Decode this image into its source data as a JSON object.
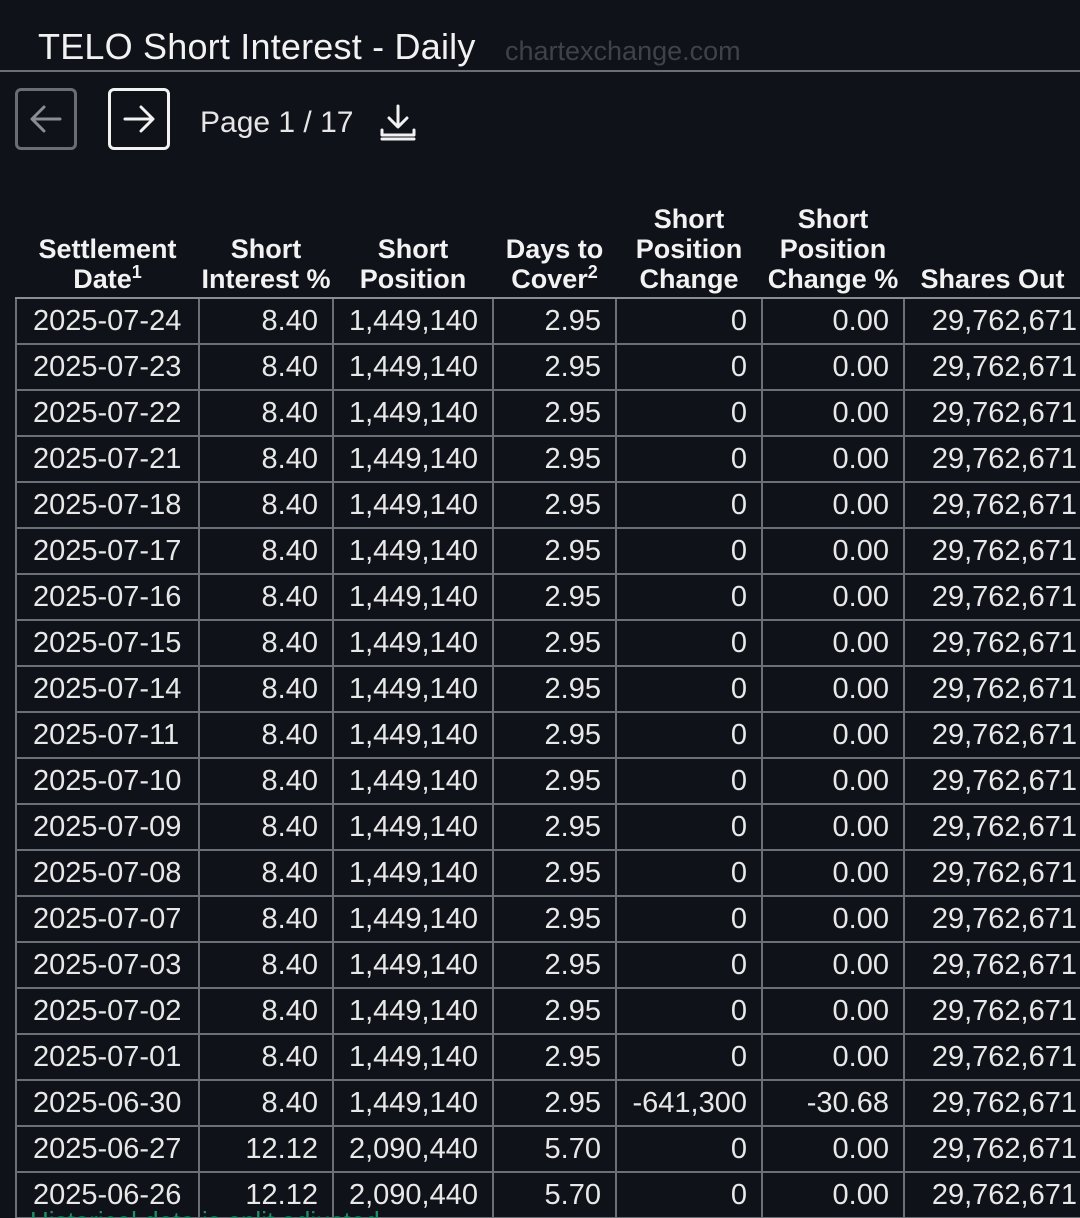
{
  "header": {
    "title": "TELO Short Interest - Daily",
    "watermark": "chartexchange.com"
  },
  "nav": {
    "prev_icon": "arrow-left-icon",
    "next_icon": "arrow-right-icon",
    "page_label": "Page 1 / 17",
    "download_icon": "download-icon"
  },
  "table": {
    "columns": [
      {
        "label": "Settlement Date",
        "sup": "1"
      },
      {
        "label": "Short Interest %",
        "sup": ""
      },
      {
        "label": "Short Position",
        "sup": ""
      },
      {
        "label": "Days to Cover",
        "sup": "2"
      },
      {
        "label": "Short Position Change",
        "sup": ""
      },
      {
        "label": "Short Position Change %",
        "sup": ""
      },
      {
        "label": "Shares Out",
        "sup": ""
      }
    ],
    "rows": [
      [
        "2025-07-24",
        "8.40",
        "1,449,140",
        "2.95",
        "0",
        "0.00",
        "29,762,671"
      ],
      [
        "2025-07-23",
        "8.40",
        "1,449,140",
        "2.95",
        "0",
        "0.00",
        "29,762,671"
      ],
      [
        "2025-07-22",
        "8.40",
        "1,449,140",
        "2.95",
        "0",
        "0.00",
        "29,762,671"
      ],
      [
        "2025-07-21",
        "8.40",
        "1,449,140",
        "2.95",
        "0",
        "0.00",
        "29,762,671"
      ],
      [
        "2025-07-18",
        "8.40",
        "1,449,140",
        "2.95",
        "0",
        "0.00",
        "29,762,671"
      ],
      [
        "2025-07-17",
        "8.40",
        "1,449,140",
        "2.95",
        "0",
        "0.00",
        "29,762,671"
      ],
      [
        "2025-07-16",
        "8.40",
        "1,449,140",
        "2.95",
        "0",
        "0.00",
        "29,762,671"
      ],
      [
        "2025-07-15",
        "8.40",
        "1,449,140",
        "2.95",
        "0",
        "0.00",
        "29,762,671"
      ],
      [
        "2025-07-14",
        "8.40",
        "1,449,140",
        "2.95",
        "0",
        "0.00",
        "29,762,671"
      ],
      [
        "2025-07-11",
        "8.40",
        "1,449,140",
        "2.95",
        "0",
        "0.00",
        "29,762,671"
      ],
      [
        "2025-07-10",
        "8.40",
        "1,449,140",
        "2.95",
        "0",
        "0.00",
        "29,762,671"
      ],
      [
        "2025-07-09",
        "8.40",
        "1,449,140",
        "2.95",
        "0",
        "0.00",
        "29,762,671"
      ],
      [
        "2025-07-08",
        "8.40",
        "1,449,140",
        "2.95",
        "0",
        "0.00",
        "29,762,671"
      ],
      [
        "2025-07-07",
        "8.40",
        "1,449,140",
        "2.95",
        "0",
        "0.00",
        "29,762,671"
      ],
      [
        "2025-07-03",
        "8.40",
        "1,449,140",
        "2.95",
        "0",
        "0.00",
        "29,762,671"
      ],
      [
        "2025-07-02",
        "8.40",
        "1,449,140",
        "2.95",
        "0",
        "0.00",
        "29,762,671"
      ],
      [
        "2025-07-01",
        "8.40",
        "1,449,140",
        "2.95",
        "0",
        "0.00",
        "29,762,671"
      ],
      [
        "2025-06-30",
        "8.40",
        "1,449,140",
        "2.95",
        "-641,300",
        "-30.68",
        "29,762,671"
      ],
      [
        "2025-06-27",
        "12.12",
        "2,090,440",
        "5.70",
        "0",
        "0.00",
        "29,762,671"
      ],
      [
        "2025-06-26",
        "12.12",
        "2,090,440",
        "5.70",
        "0",
        "0.00",
        "29,762,671"
      ]
    ]
  },
  "footnote": "Historical data is split adjusted",
  "colors": {
    "background": "#0f1218",
    "border": "#6b6f76",
    "text": "#e8e8e8",
    "footnote": "#1f8f6a"
  }
}
